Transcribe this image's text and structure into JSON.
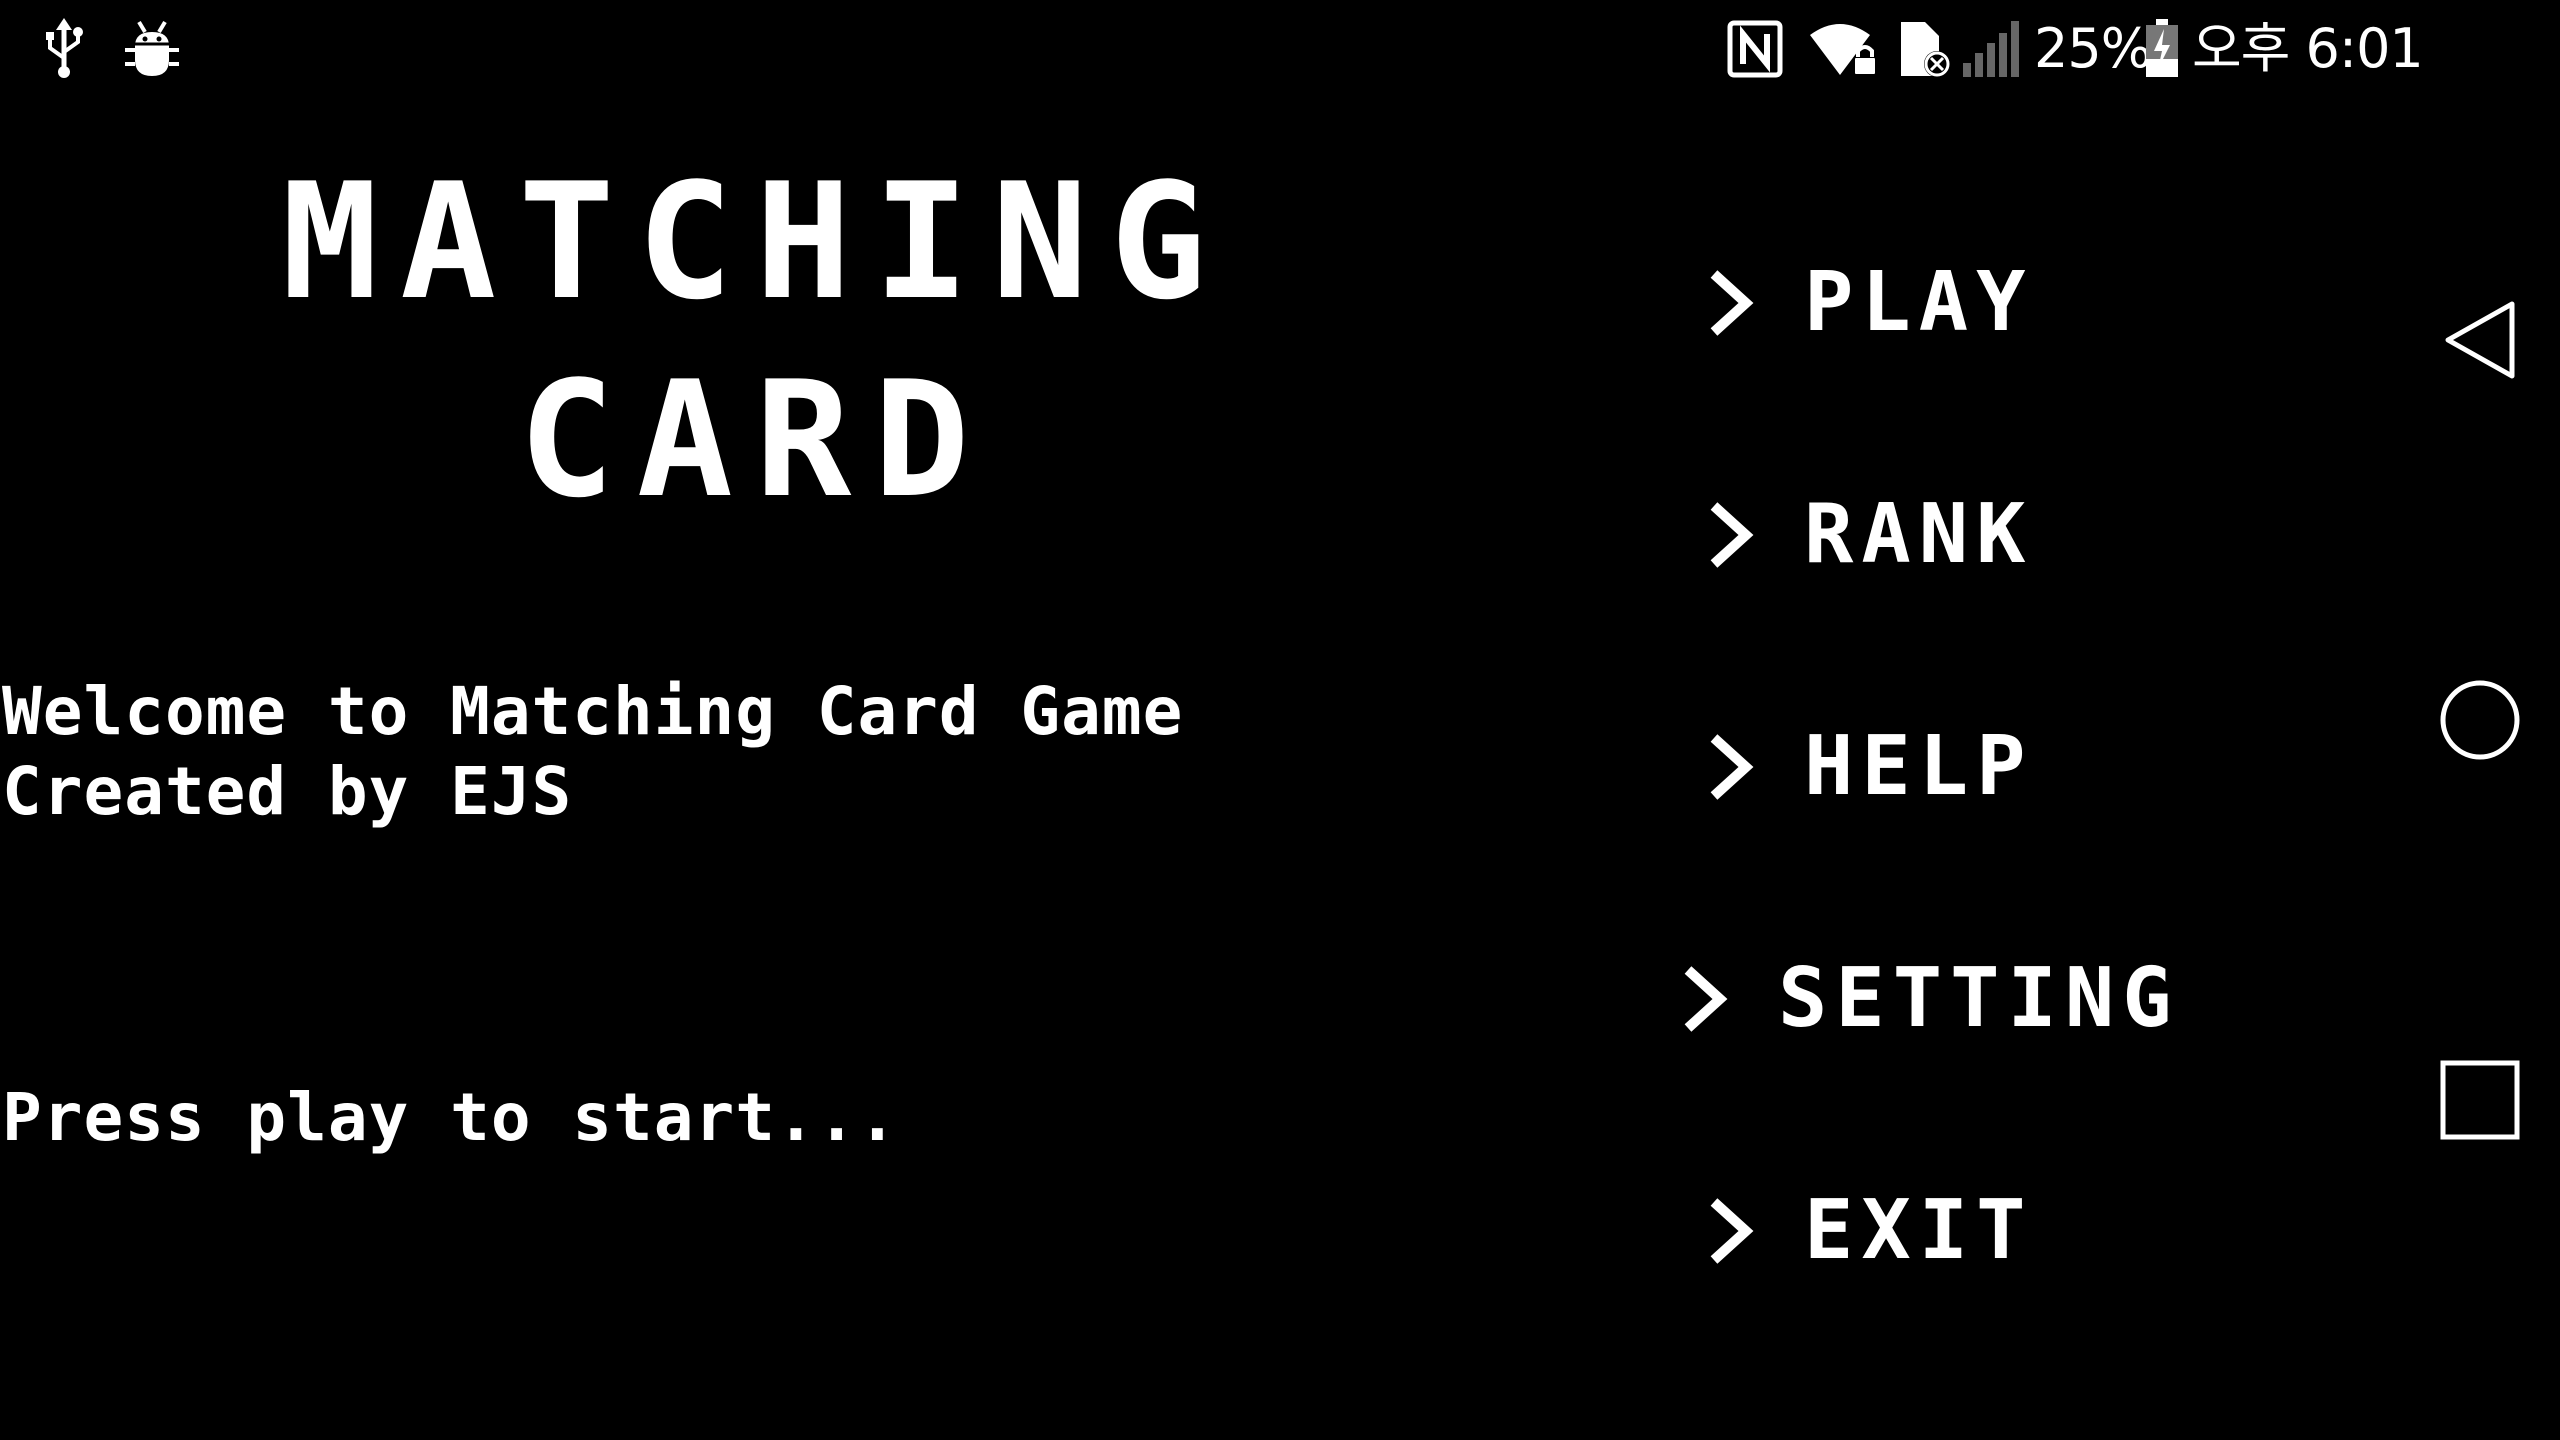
{
  "status_bar": {
    "battery_percent": "25%",
    "time": "오후 6:01",
    "icons": [
      "usb-icon",
      "debug-bug-icon",
      "nfc-icon",
      "wifi-locked-icon",
      "no-sim-icon",
      "signal-icon",
      "battery-charging-icon"
    ]
  },
  "game": {
    "title_line1": "MATCHING",
    "title_line2": "CARD",
    "welcome_line1": "Welcome to Matching Card Game",
    "welcome_line2": "Created by EJS",
    "prompt": "Press play to start..."
  },
  "menu": {
    "items": [
      {
        "label": "PLAY"
      },
      {
        "label": "RANK"
      },
      {
        "label": "HELP"
      },
      {
        "label": "SETTING"
      },
      {
        "label": "EXIT"
      }
    ]
  },
  "nav_bar": {
    "buttons": [
      "back-icon",
      "home-icon",
      "recents-icon"
    ]
  }
}
